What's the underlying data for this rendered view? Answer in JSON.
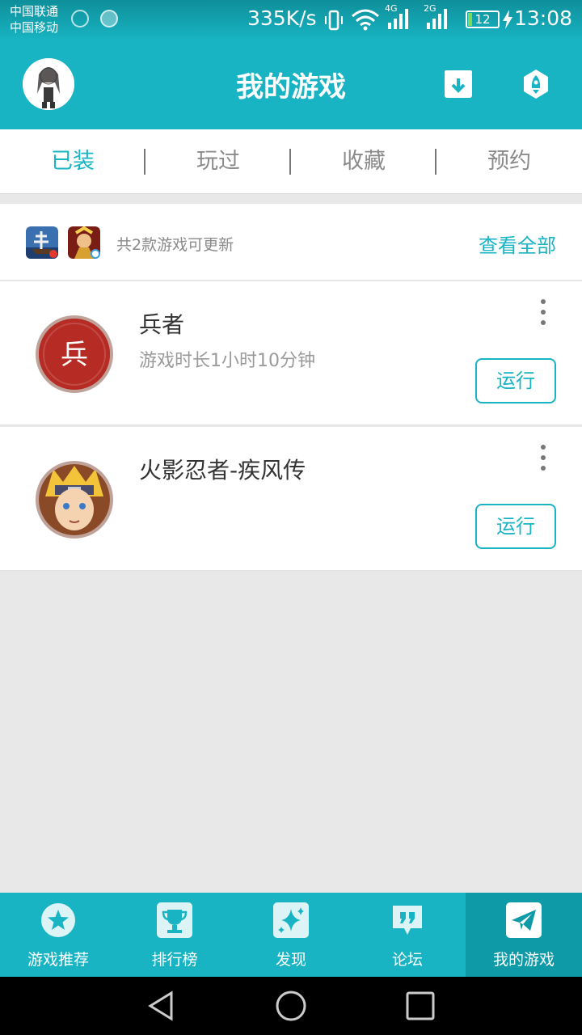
{
  "status_bar": {
    "carrier_1": "中国联通",
    "carrier_2": "中国移动",
    "net_speed": "335K/s",
    "net_1": "4G",
    "net_2": "2G",
    "battery": "12",
    "battery_level": 0.12,
    "time": "13:08"
  },
  "header": {
    "title": "我的游戏",
    "avatar_icon": "user-avatar",
    "download_icon": "download-box-icon",
    "boost_icon": "rocket-icon"
  },
  "tabs": [
    {
      "label": "已装",
      "active": true
    },
    {
      "label": "玩过",
      "active": false
    },
    {
      "label": "收藏",
      "active": false
    },
    {
      "label": "预约",
      "active": false
    }
  ],
  "update_bar": {
    "text": "共2款游戏可更新",
    "view_all": "查看全部"
  },
  "games": [
    {
      "name": "兵者",
      "meta": "游戏时长1小时10分钟",
      "icon_char": "兵",
      "run": "运行"
    },
    {
      "name": "火影忍者-疾风传",
      "meta": "",
      "run": "运行"
    }
  ],
  "bottom_nav": [
    {
      "label": "游戏推荐",
      "icon": "star-icon",
      "active": false
    },
    {
      "label": "排行榜",
      "icon": "trophy-icon",
      "active": false
    },
    {
      "label": "发现",
      "icon": "sparkle-icon",
      "active": false
    },
    {
      "label": "论坛",
      "icon": "quote-bubble-icon",
      "active": false
    },
    {
      "label": "我的游戏",
      "icon": "paper-plane-icon",
      "active": true
    }
  ],
  "colors": {
    "accent": "#18b4c3",
    "accent_dark": "#0f9aa7",
    "background": "#e8e8e8"
  }
}
